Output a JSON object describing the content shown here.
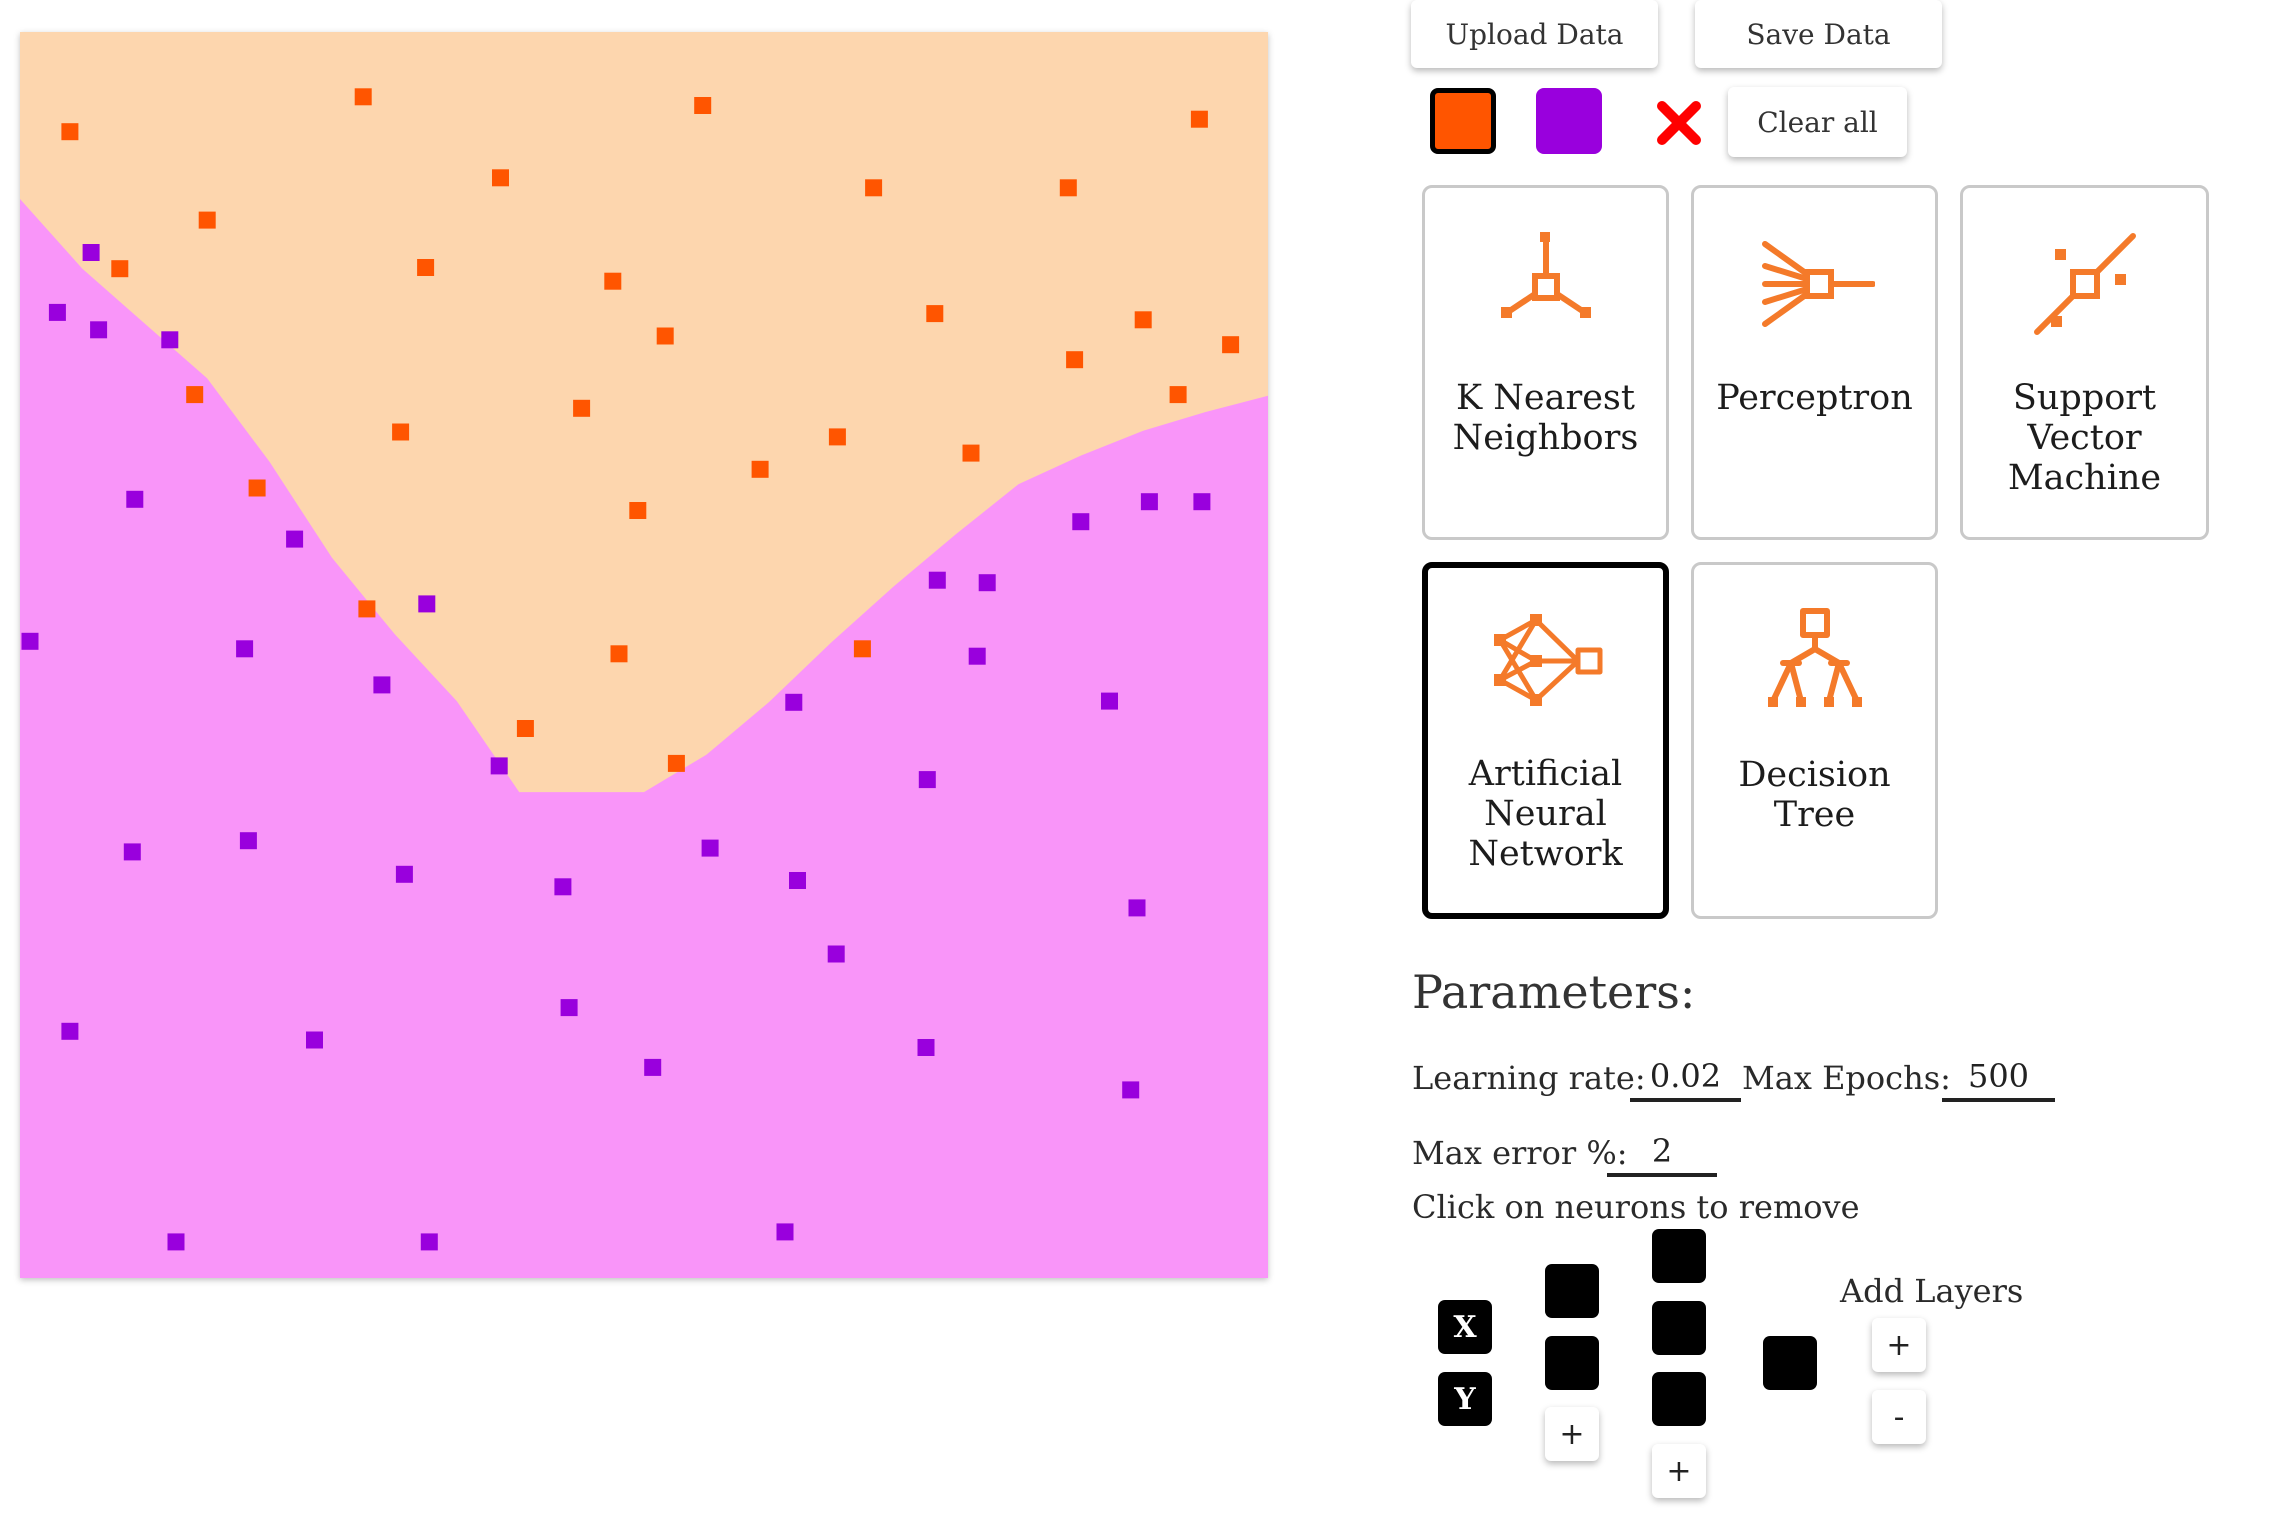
{
  "toolbar": {
    "upload_label": "Upload Data",
    "save_label": "Save Data",
    "clear_label": "Clear all"
  },
  "classes": {
    "class_a_color": "#ff5500",
    "class_b_color": "#9900dd",
    "region_a_color": "#fdd6ae",
    "region_b_color": "#f995f9",
    "selected_class": "class_a"
  },
  "models": [
    {
      "label": "K Nearest\nNeighbors",
      "icon": "knn-icon",
      "selected": false
    },
    {
      "label": "Perceptron",
      "icon": "perceptron-icon",
      "selected": false
    },
    {
      "label": "Support\nVector\nMachine",
      "icon": "svm-icon",
      "selected": false
    },
    {
      "label": "Artificial\nNeural\nNetwork",
      "icon": "ann-icon",
      "selected": true
    },
    {
      "label": "Decision\nTree",
      "icon": "decision-tree-icon",
      "selected": false
    }
  ],
  "parameters": {
    "title": "Parameters:",
    "learning_rate_label": "Learning rate:",
    "learning_rate": "0.02",
    "max_epochs_label": "Max Epochs:",
    "max_epochs": "500",
    "max_error_label": "Max error %:",
    "max_error": "2"
  },
  "network": {
    "hint": "Click on neurons to remove",
    "inputs": [
      "X",
      "Y"
    ],
    "hidden_layers": [
      2,
      3
    ],
    "outputs": 1,
    "add_neuron_label": "+",
    "add_layers_label": "Add Layers",
    "add_layer_label": "+",
    "remove_layer_label": "-"
  },
  "chart_data": {
    "type": "scatter",
    "xlim": [
      0,
      1
    ],
    "ylim": [
      0,
      1
    ],
    "grid": false,
    "series": [
      {
        "color": "#ff5500",
        "points": [
          [
            0.04,
            0.92
          ],
          [
            0.275,
            0.948
          ],
          [
            0.547,
            0.941
          ],
          [
            0.945,
            0.93
          ],
          [
            0.385,
            0.883
          ],
          [
            0.684,
            0.875
          ],
          [
            0.84,
            0.875
          ],
          [
            0.15,
            0.849
          ],
          [
            0.08,
            0.81
          ],
          [
            0.325,
            0.811
          ],
          [
            0.475,
            0.8
          ],
          [
            0.733,
            0.774
          ],
          [
            0.9,
            0.769
          ],
          [
            0.517,
            0.756
          ],
          [
            0.97,
            0.749
          ],
          [
            0.845,
            0.737
          ],
          [
            0.14,
            0.709
          ],
          [
            0.928,
            0.709
          ],
          [
            0.45,
            0.698
          ],
          [
            0.305,
            0.679
          ],
          [
            0.655,
            0.675
          ],
          [
            0.593,
            0.649
          ],
          [
            0.762,
            0.662
          ],
          [
            0.19,
            0.634
          ],
          [
            0.495,
            0.616
          ],
          [
            0.278,
            0.537
          ],
          [
            0.48,
            0.501
          ],
          [
            0.675,
            0.505
          ],
          [
            0.405,
            0.441
          ],
          [
            0.526,
            0.413
          ]
        ]
      },
      {
        "color": "#9900dd",
        "points": [
          [
            0.057,
            0.823
          ],
          [
            0.03,
            0.775
          ],
          [
            0.063,
            0.761
          ],
          [
            0.12,
            0.753
          ],
          [
            0.092,
            0.625
          ],
          [
            0.22,
            0.593
          ],
          [
            0.008,
            0.511
          ],
          [
            0.18,
            0.505
          ],
          [
            0.326,
            0.541
          ],
          [
            0.29,
            0.476
          ],
          [
            0.735,
            0.56
          ],
          [
            0.775,
            0.558
          ],
          [
            0.85,
            0.607
          ],
          [
            0.905,
            0.623
          ],
          [
            0.947,
            0.623
          ],
          [
            0.767,
            0.499
          ],
          [
            0.873,
            0.463
          ],
          [
            0.62,
            0.462
          ],
          [
            0.384,
            0.411
          ],
          [
            0.727,
            0.4
          ],
          [
            0.09,
            0.342
          ],
          [
            0.183,
            0.351
          ],
          [
            0.308,
            0.324
          ],
          [
            0.553,
            0.345
          ],
          [
            0.623,
            0.319
          ],
          [
            0.435,
            0.314
          ],
          [
            0.895,
            0.297
          ],
          [
            0.654,
            0.26
          ],
          [
            0.44,
            0.217
          ],
          [
            0.04,
            0.198
          ],
          [
            0.236,
            0.191
          ],
          [
            0.726,
            0.185
          ],
          [
            0.507,
            0.169
          ],
          [
            0.89,
            0.151
          ],
          [
            0.125,
            0.029
          ],
          [
            0.328,
            0.029
          ],
          [
            0.613,
            0.037
          ]
        ]
      }
    ],
    "boundary": [
      [
        0,
        0.866
      ],
      [
        0.05,
        0.81
      ],
      [
        0.1,
        0.766
      ],
      [
        0.15,
        0.722
      ],
      [
        0.2,
        0.655
      ],
      [
        0.25,
        0.578
      ],
      [
        0.3,
        0.517
      ],
      [
        0.35,
        0.463
      ],
      [
        0.4,
        0.39
      ],
      [
        0.45,
        0.39
      ],
      [
        0.5,
        0.39
      ],
      [
        0.55,
        0.42
      ],
      [
        0.6,
        0.462
      ],
      [
        0.65,
        0.51
      ],
      [
        0.7,
        0.555
      ],
      [
        0.75,
        0.597
      ],
      [
        0.8,
        0.637
      ],
      [
        0.85,
        0.66
      ],
      [
        0.9,
        0.68
      ],
      [
        0.95,
        0.695
      ],
      [
        1,
        0.708
      ]
    ]
  }
}
